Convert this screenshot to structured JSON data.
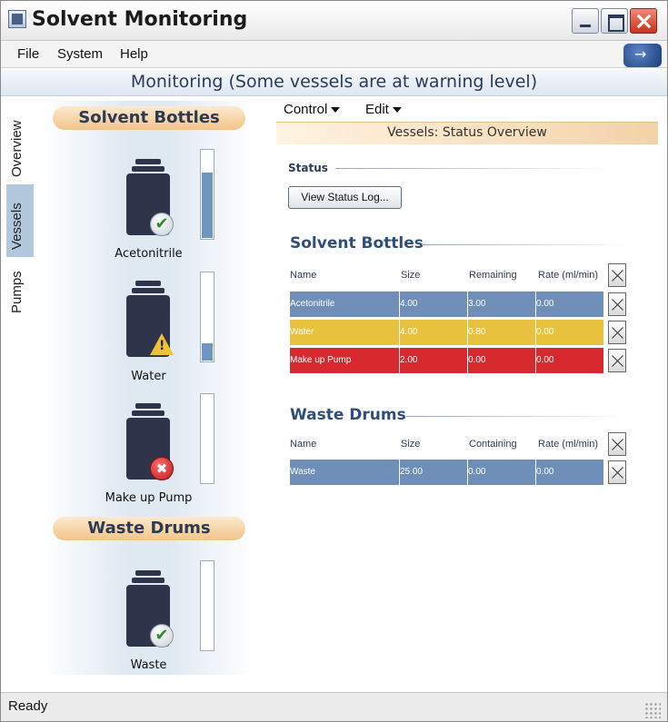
{
  "window": {
    "title": "Solvent Monitoring"
  },
  "menu": {
    "file": "File",
    "system": "System",
    "help": "Help"
  },
  "header": {
    "title": "Monitoring (Some vessels are at warning level)"
  },
  "tabs": [
    {
      "label": "Overview"
    },
    {
      "label": "Vessels"
    },
    {
      "label": "Pumps"
    }
  ],
  "sidebar": {
    "solvent_title": "Solvent Bottles",
    "waste_title": "Waste Drums",
    "vessels": [
      {
        "label": "Acetonitrile",
        "status": "ok",
        "level": 0.75
      },
      {
        "label": "Water",
        "status": "warning",
        "level": 0.2
      },
      {
        "label": "Make up Pump",
        "status": "error",
        "level": 0.0
      },
      {
        "label": "Waste",
        "status": "ok",
        "level": 0.0
      }
    ],
    "glyphs": {
      "ok": "✔",
      "error": "✖"
    }
  },
  "toolbar": {
    "control": "Control",
    "edit": "Edit"
  },
  "section_title": "Vessels: Status Overview",
  "status": {
    "label": "Status",
    "button": "View Status Log..."
  },
  "solvent_table": {
    "title": "Solvent Bottles",
    "headers": [
      "Name",
      "Size",
      "Remaining",
      "Rate (ml/min)"
    ],
    "rows": [
      {
        "name": "Acetonitrile",
        "size": "4.00",
        "remaining": "3.00",
        "rate": "0.00",
        "color": "#6f8fb9"
      },
      {
        "name": "Water",
        "size": "4.00",
        "remaining": "0.80",
        "rate": "0.00",
        "color": "#e8c23f"
      },
      {
        "name": "Make up Pump",
        "size": "2.00",
        "remaining": "0.00",
        "rate": "0.00",
        "color": "#d8292f"
      }
    ]
  },
  "waste_table": {
    "title": "Waste Drums",
    "headers": [
      "Name",
      "Size",
      "Containing",
      "Rate (ml/min)"
    ],
    "rows": [
      {
        "name": "Waste",
        "size": "25.00",
        "containing": "0.00",
        "rate": "0.00",
        "color": "#6f8fb9"
      }
    ]
  },
  "statusbar": {
    "text": "Ready"
  }
}
